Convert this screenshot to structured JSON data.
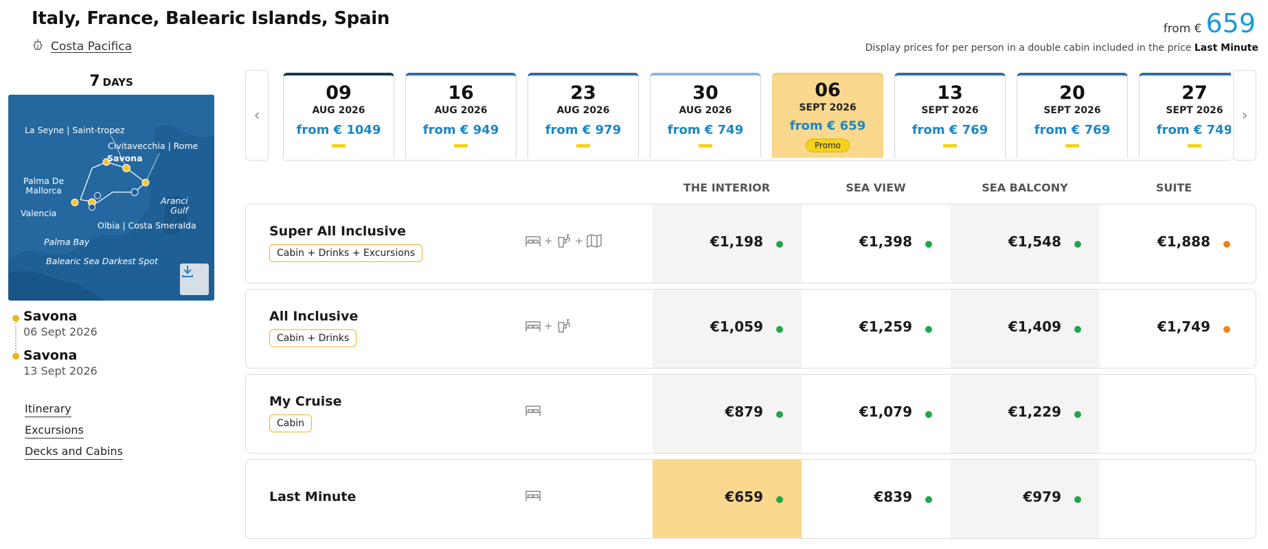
{
  "header": {
    "title": "Italy, France, Balearic Islands, Spain",
    "ship_name": "Costa Pacifica",
    "from_label": "from €",
    "from_price": "659",
    "display_note_prefix": "Display prices for per person in a double cabin included in the price",
    "display_note_bold": "Last Minute"
  },
  "trip": {
    "days_number": "7",
    "days_label": "DAYS",
    "map_labels": {
      "la_seyne": "La Seyne | Saint-tropez",
      "civitavecchia": "Civitavecchia | Rome",
      "savona": "Savona",
      "palma": "Palma De\nMallorca",
      "aranci": "Aranci\nGulf",
      "valencia": "Valencia",
      "olbia": "Olbia | Costa Smeralda",
      "palma_bay": "Palma Bay",
      "balearic": "Balearic Sea Darkest Spot"
    },
    "ports": [
      {
        "name": "Savona",
        "date": "06 Sept 2026"
      },
      {
        "name": "Savona",
        "date": "13 Sept 2026"
      }
    ],
    "links": [
      "Itinerary",
      "Excursions",
      "Decks and Cabins"
    ]
  },
  "dates": [
    {
      "day": "09",
      "month": "AUG 2026",
      "price": "from € 1049"
    },
    {
      "day": "16",
      "month": "AUG 2026",
      "price": "from € 949"
    },
    {
      "day": "23",
      "month": "AUG 2026",
      "price": "from € 979"
    },
    {
      "day": "30",
      "month": "AUG 2026",
      "price": "from € 749"
    },
    {
      "day": "06",
      "month": "SEPT 2026",
      "price": "from € 659",
      "badge": "Promo"
    },
    {
      "day": "13",
      "month": "SEPT 2026",
      "price": "from € 769"
    },
    {
      "day": "20",
      "month": "SEPT 2026",
      "price": "from € 769"
    },
    {
      "day": "27",
      "month": "SEPT 2026",
      "price": "from € 749"
    }
  ],
  "cabins": {
    "headers": [
      "THE INTERIOR",
      "SEA VIEW",
      "SEA BALCONY",
      "SUITE"
    ]
  },
  "packages": [
    {
      "name": "Super All Inclusive",
      "tag": "Cabin + Drinks + Excursions",
      "icons": [
        "bed-icon",
        "drink-icon",
        "map-icon"
      ],
      "prices": [
        "€1,198",
        "€1,398",
        "€1,548",
        "€1,888"
      ],
      "status": [
        "green",
        "green",
        "green",
        "orange"
      ]
    },
    {
      "name": "All Inclusive",
      "tag": "Cabin + Drinks",
      "icons": [
        "bed-icon",
        "drink-icon"
      ],
      "prices": [
        "€1,059",
        "€1,259",
        "€1,409",
        "€1,749"
      ],
      "status": [
        "green",
        "green",
        "green",
        "orange"
      ]
    },
    {
      "name": "My Cruise",
      "tag": "Cabin",
      "icons": [
        "bed-icon"
      ],
      "prices": [
        "€879",
        "€1,079",
        "€1,229",
        ""
      ],
      "status": [
        "green",
        "green",
        "green",
        ""
      ]
    },
    {
      "name": "Last Minute",
      "tag": "",
      "icons": [
        "bed-icon"
      ],
      "prices": [
        "€659",
        "€839",
        "€979",
        ""
      ],
      "status": [
        "green",
        "green",
        "green",
        ""
      ]
    }
  ],
  "colors": {
    "accent": "#1a9ad6",
    "promo": "#f5d21c",
    "highlight": "#fad88d",
    "available": "#1fa64a",
    "limited": "#f0821e"
  }
}
